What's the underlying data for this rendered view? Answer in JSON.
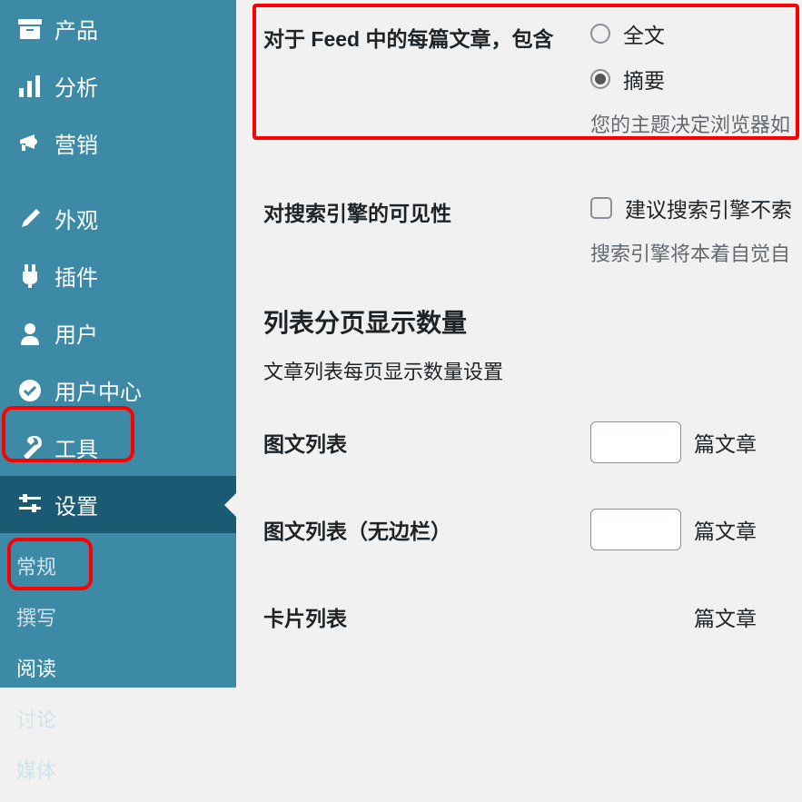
{
  "sidebar": {
    "items": [
      {
        "label": "产品",
        "icon": "archive-icon"
      },
      {
        "label": "分析",
        "icon": "chart-icon"
      },
      {
        "label": "营销",
        "icon": "megaphone-icon"
      },
      {
        "label": "外观",
        "icon": "brush-icon"
      },
      {
        "label": "插件",
        "icon": "plug-icon"
      },
      {
        "label": "用户",
        "icon": "user-icon"
      },
      {
        "label": "用户中心",
        "icon": "check-circle-icon"
      },
      {
        "label": "工具",
        "icon": "wrench-icon"
      },
      {
        "label": "设置",
        "icon": "sliders-icon",
        "selected": true
      }
    ],
    "submenu": [
      {
        "label": "常规"
      },
      {
        "label": "撰写"
      },
      {
        "label": "阅读",
        "active": true
      },
      {
        "label": "讨论"
      },
      {
        "label": "媒体"
      }
    ]
  },
  "settings": {
    "feed": {
      "label": "对于 Feed 中的每篇文章，包含",
      "options": [
        {
          "label": "全文",
          "checked": false
        },
        {
          "label": "摘要",
          "checked": true
        }
      ],
      "hint": "您的主题决定浏览器如"
    },
    "search": {
      "label": "对搜索引擎的可见性",
      "checkbox_label": "建议搜索引擎不索",
      "hint": "搜索引擎将本着自觉自"
    },
    "pagination": {
      "heading": "列表分页显示数量",
      "desc": "文章列表每页显示数量设置",
      "rows": [
        {
          "label": "图文列表",
          "suffix": "篇文章"
        },
        {
          "label": "图文列表（无边栏）",
          "suffix": "篇文章"
        },
        {
          "label": "卡片列表",
          "suffix": "篇文章"
        }
      ]
    }
  }
}
